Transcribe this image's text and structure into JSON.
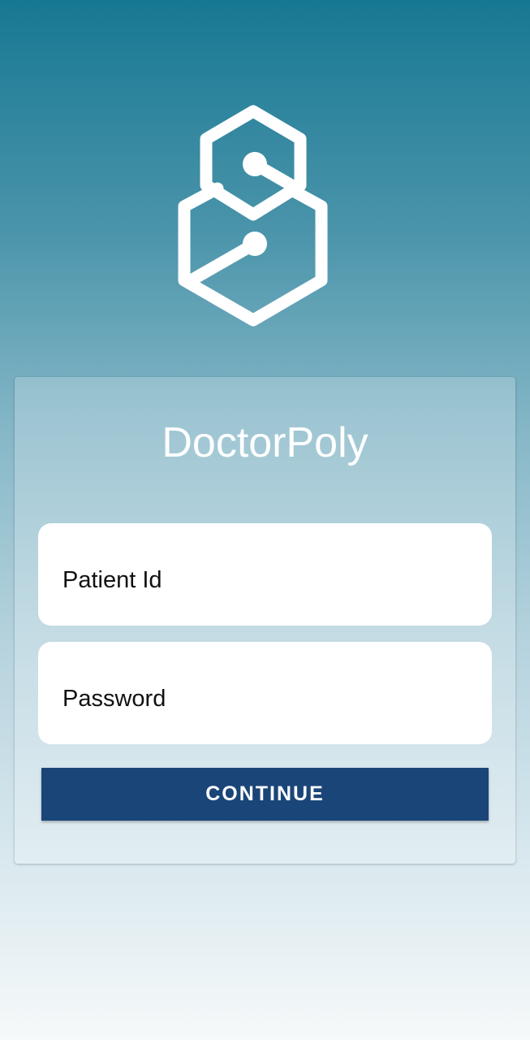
{
  "app": {
    "name": "DoctorPoly",
    "logo_icon": "hexagon-link-logo-icon"
  },
  "login": {
    "patient_id_placeholder": "Patient Id",
    "password_placeholder": "Password",
    "continue_label": "CONTINUE"
  },
  "colors": {
    "brand_teal": "#177893",
    "button": "#1a4578",
    "text_on_brand": "#ffffff"
  }
}
